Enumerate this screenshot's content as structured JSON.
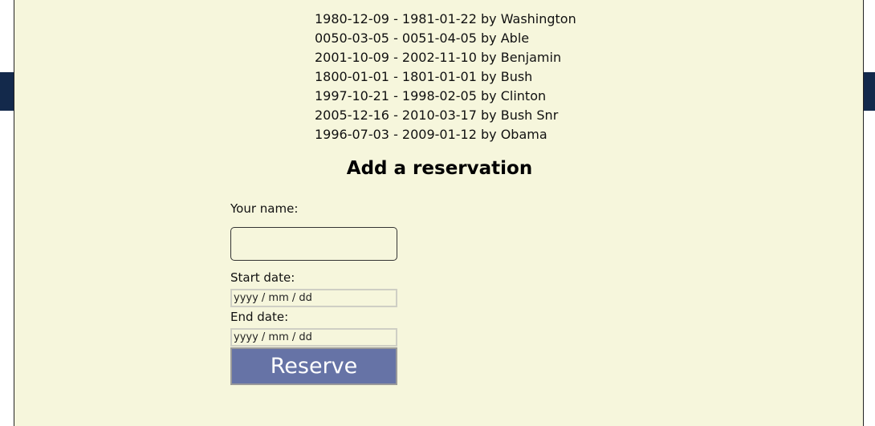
{
  "reservations": [
    "1980-12-09 - 1981-01-22 by Washington",
    "0050-03-05 - 0051-04-05 by Able",
    "2001-10-09 - 2002-11-10 by Benjamin",
    "1800-01-01 - 1801-01-01 by Bush",
    "1997-10-21 - 1998-02-05 by Clinton",
    "2005-12-16 - 2010-03-17 by Bush Snr",
    "1996-07-03 - 2009-01-12 by Obama"
  ],
  "form": {
    "heading": "Add a reservation",
    "name_label": "Your name:",
    "name_value": "",
    "start_label": "Start date:",
    "start_placeholder": "yyyy / mm / dd",
    "end_label": "End date:",
    "end_placeholder": "yyyy / mm / dd",
    "submit_label": "Reserve"
  },
  "colors": {
    "panel_background": "#f6f6dc",
    "header_band": "#13294b",
    "button_background": "#6673a6",
    "button_text": "#ffffff"
  }
}
